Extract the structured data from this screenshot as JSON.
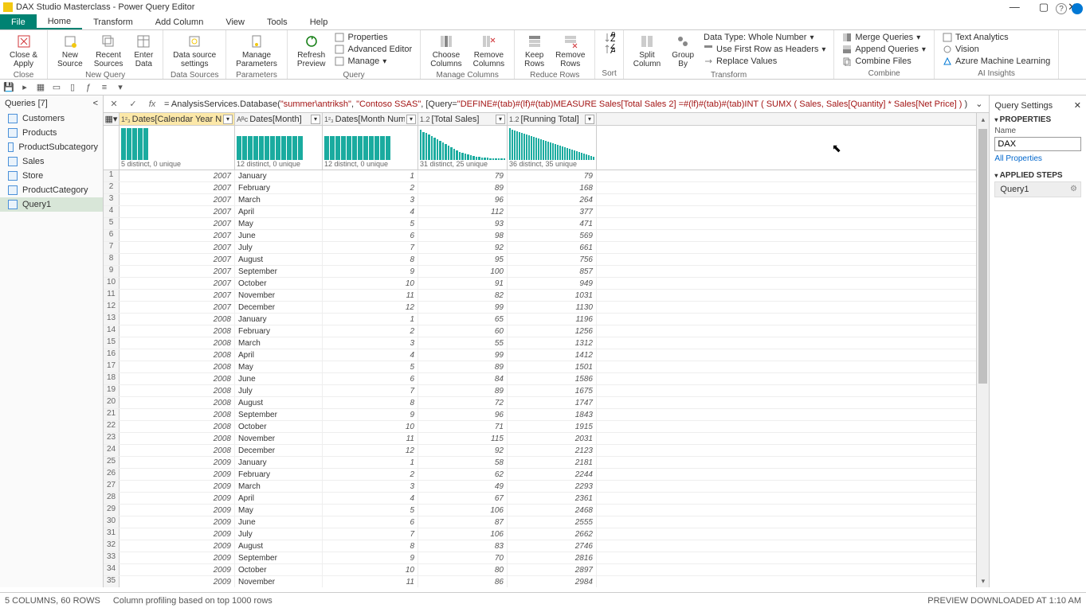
{
  "window": {
    "title": "DAX Studio Masterclass - Power Query Editor",
    "minimize": "—",
    "maximize": "▢",
    "close": "✕"
  },
  "menu": {
    "file": "File",
    "home": "Home",
    "transform": "Transform",
    "addcol": "Add Column",
    "view": "View",
    "tools": "Tools",
    "help": "Help"
  },
  "ribbon": {
    "close": {
      "btn": "Close &\nApply",
      "label": "Close"
    },
    "newquery": {
      "b1": "New\nSource",
      "b2": "Recent\nSources",
      "b3": "Enter\nData",
      "label": "New Query"
    },
    "datasources": {
      "b1": "Data source\nsettings",
      "label": "Data Sources"
    },
    "params": {
      "b1": "Manage\nParameters",
      "label": "Parameters"
    },
    "query": {
      "b1": "Refresh\nPreview",
      "i1": "Properties",
      "i2": "Advanced Editor",
      "i3": "Manage",
      "label": "Query"
    },
    "mcols": {
      "b1": "Choose\nColumns",
      "b2": "Remove\nColumns",
      "label": "Manage Columns"
    },
    "rrows": {
      "b1": "Keep\nRows",
      "b2": "Remove\nRows",
      "label": "Reduce Rows"
    },
    "sort": {
      "label": "Sort"
    },
    "transform": {
      "b1": "Split\nColumn",
      "b2": "Group\nBy",
      "i1": "Data Type: Whole Number",
      "i2": "Use First Row as Headers",
      "i3": "Replace Values",
      "label": "Transform"
    },
    "combine": {
      "i1": "Merge Queries",
      "i2": "Append Queries",
      "i3": "Combine Files",
      "label": "Combine"
    },
    "ai": {
      "i1": "Text Analytics",
      "i2": "Vision",
      "i3": "Azure Machine Learning",
      "label": "AI Insights"
    }
  },
  "queries": {
    "header": "Queries [7]",
    "items": [
      "Customers",
      "Products",
      "ProductSubcategory",
      "Sales",
      "Store",
      "ProductCategory",
      "Query1"
    ],
    "selected": 6
  },
  "formula": {
    "prefix": "= AnalysisServices.Database(",
    "s1": "\"summer\\antriksh\"",
    "c1": ", ",
    "s2": "\"Contoso SSAS\"",
    "c2": ", [Query=",
    "s3": "\"DEFINE#(tab)#(lf)#(tab)MEASURE Sales[Total Sales 2] =#(lf)#(tab)#(tab)INT ( SUMX ( Sales, Sales[Quantity] * Sales[Net Price] )",
    "suffix": " )"
  },
  "columns": [
    {
      "type": "1²₃",
      "name": "Dates[Calendar Year Number]",
      "stat": "5 distinct, 0 unique",
      "w": "c1",
      "num": true
    },
    {
      "type": "Aᴮc",
      "name": "Dates[Month]",
      "stat": "12 distinct, 0 unique",
      "w": "c2",
      "num": false
    },
    {
      "type": "1²₃",
      "name": "Dates[Month Number]",
      "stat": "12 distinct, 0 unique",
      "w": "c3",
      "num": true
    },
    {
      "type": "1.2",
      "name": "[Total Sales]",
      "stat": "31 distinct, 25 unique",
      "w": "c4",
      "num": true
    },
    {
      "type": "1.2",
      "name": "[Running Total]",
      "stat": "36 distinct, 35 unique",
      "w": "c5",
      "num": true
    }
  ],
  "rows": [
    [
      2007,
      "January",
      1,
      79,
      79
    ],
    [
      2007,
      "February",
      2,
      89,
      168
    ],
    [
      2007,
      "March",
      3,
      96,
      264
    ],
    [
      2007,
      "April",
      4,
      112,
      377
    ],
    [
      2007,
      "May",
      5,
      93,
      471
    ],
    [
      2007,
      "June",
      6,
      98,
      569
    ],
    [
      2007,
      "July",
      7,
      92,
      661
    ],
    [
      2007,
      "August",
      8,
      95,
      756
    ],
    [
      2007,
      "September",
      9,
      100,
      857
    ],
    [
      2007,
      "October",
      10,
      91,
      949
    ],
    [
      2007,
      "November",
      11,
      82,
      1031
    ],
    [
      2007,
      "December",
      12,
      99,
      1130
    ],
    [
      2008,
      "January",
      1,
      65,
      1196
    ],
    [
      2008,
      "February",
      2,
      60,
      1256
    ],
    [
      2008,
      "March",
      3,
      55,
      1312
    ],
    [
      2008,
      "April",
      4,
      99,
      1412
    ],
    [
      2008,
      "May",
      5,
      89,
      1501
    ],
    [
      2008,
      "June",
      6,
      84,
      1586
    ],
    [
      2008,
      "July",
      7,
      89,
      1675
    ],
    [
      2008,
      "August",
      8,
      72,
      1747
    ],
    [
      2008,
      "September",
      9,
      96,
      1843
    ],
    [
      2008,
      "October",
      10,
      71,
      1915
    ],
    [
      2008,
      "November",
      11,
      115,
      2031
    ],
    [
      2008,
      "December",
      12,
      92,
      2123
    ],
    [
      2009,
      "January",
      1,
      58,
      2181
    ],
    [
      2009,
      "February",
      2,
      62,
      2244
    ],
    [
      2009,
      "March",
      3,
      49,
      2293
    ],
    [
      2009,
      "April",
      4,
      67,
      2361
    ],
    [
      2009,
      "May",
      5,
      106,
      2468
    ],
    [
      2009,
      "June",
      6,
      87,
      2555
    ],
    [
      2009,
      "July",
      7,
      106,
      2662
    ],
    [
      2009,
      "August",
      8,
      83,
      2746
    ],
    [
      2009,
      "September",
      9,
      70,
      2816
    ],
    [
      2009,
      "October",
      10,
      80,
      2897
    ],
    [
      2009,
      "November",
      11,
      86,
      2984
    ]
  ],
  "profiles": [
    [
      40,
      40,
      40,
      40,
      40
    ],
    [
      30,
      30,
      30,
      30,
      30,
      30,
      30,
      30,
      30,
      30,
      30,
      30
    ],
    [
      30,
      30,
      30,
      30,
      30,
      30,
      30,
      30,
      30,
      30,
      30,
      30
    ],
    [
      38,
      35,
      34,
      32,
      30,
      28,
      26,
      24,
      22,
      20,
      18,
      16,
      14,
      12,
      10,
      9,
      8,
      7,
      6,
      5,
      4,
      4,
      3,
      3,
      3,
      2,
      2,
      2,
      2,
      2,
      2
    ],
    [
      40,
      38,
      37,
      36,
      35,
      34,
      33,
      32,
      31,
      30,
      29,
      28,
      27,
      26,
      25,
      24,
      23,
      22,
      21,
      20,
      19,
      18,
      17,
      16,
      15,
      14,
      13,
      12,
      11,
      10,
      9,
      8,
      7,
      6,
      5,
      4
    ]
  ],
  "settings": {
    "title": "Query Settings",
    "properties": "PROPERTIES",
    "namelabel": "Name",
    "namevalue": "DAX ",
    "allprops": "All Properties",
    "steps": "APPLIED STEPS",
    "step1": "Query1"
  },
  "status": {
    "left1": "5 COLUMNS, 60 ROWS",
    "left2": "Column profiling based on top 1000 rows",
    "right": "PREVIEW DOWNLOADED AT 1:10 AM"
  }
}
